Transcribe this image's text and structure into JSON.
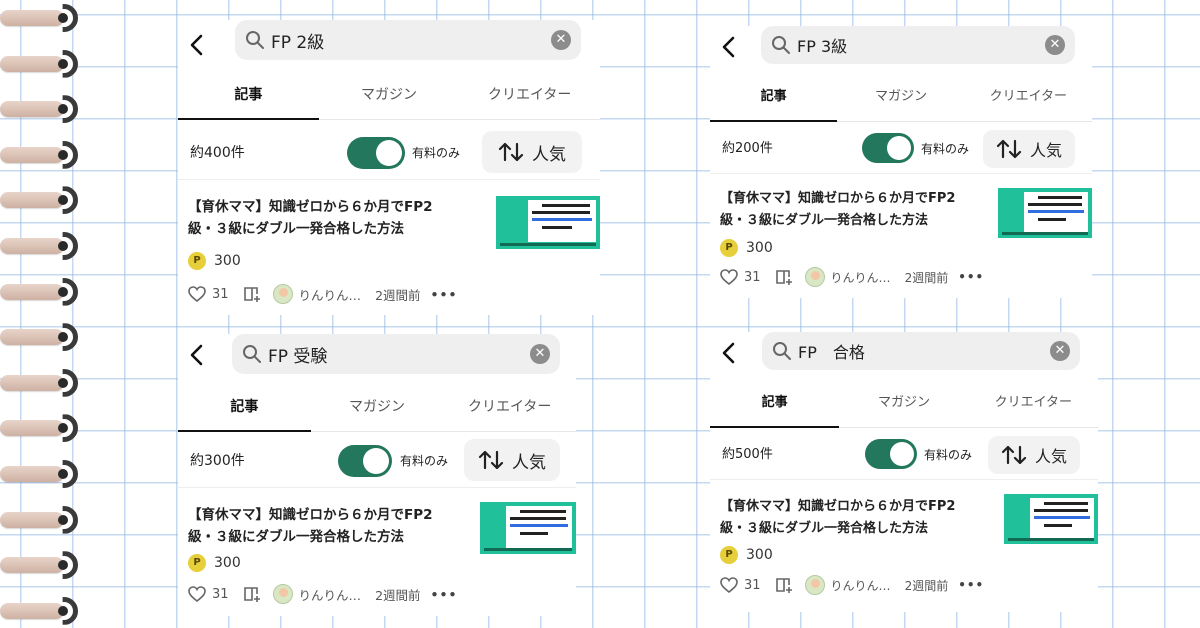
{
  "panels": [
    {
      "search_query": "FP 2級",
      "tabs": [
        "記事",
        "マガジン",
        "クリエイター"
      ],
      "count": "約400件",
      "toggle_label": "有料のみ",
      "sort_label": "人気",
      "article": {
        "title_line1": "【育休ママ】知識ゼロから６か月でFP2",
        "title_line2": "級・３級にダブル一発合格した方法",
        "coin": "P",
        "price": "300",
        "likes": "31",
        "author": "りんりん…",
        "date": "2週間前",
        "more": "•••"
      }
    },
    {
      "search_query": "FP 3級",
      "tabs": [
        "記事",
        "マガジン",
        "クリエイター"
      ],
      "count": "約200件",
      "toggle_label": "有料のみ",
      "sort_label": "人気",
      "article": {
        "title_line1": "【育休ママ】知識ゼロから６か月でFP2",
        "title_line2": "級・３級にダブル一発合格した方法",
        "coin": "P",
        "price": "300",
        "likes": "31",
        "author": "りんりん…",
        "date": "2週間前",
        "more": "•••"
      }
    },
    {
      "search_query": "FP 受験",
      "tabs": [
        "記事",
        "マガジン",
        "クリエイター"
      ],
      "count": "約300件",
      "toggle_label": "有料のみ",
      "sort_label": "人気",
      "article": {
        "title_line1": "【育休ママ】知識ゼロから６か月でFP2",
        "title_line2": "級・３級にダブル一発合格した方法",
        "coin": "P",
        "price": "300",
        "likes": "31",
        "author": "りんりん…",
        "date": "2週間前",
        "more": "•••"
      }
    },
    {
      "search_query": "FP　合格",
      "tabs": [
        "記事",
        "マガジン",
        "クリエイター"
      ],
      "count": "約500件",
      "toggle_label": "有料のみ",
      "sort_label": "人気",
      "article": {
        "title_line1": "【育休ママ】知識ゼロから６か月でFP2",
        "title_line2": "級・３級にダブル一発合格した方法",
        "coin": "P",
        "price": "300",
        "likes": "31",
        "author": "りんりん…",
        "date": "2週間前",
        "more": "•••"
      }
    }
  ],
  "colors": {
    "toggle_on": "#23775c",
    "thumbnail_green": "#1fc09a",
    "coin_yellow": "#e6cf3a",
    "grid_blue": "#96b9e6"
  }
}
